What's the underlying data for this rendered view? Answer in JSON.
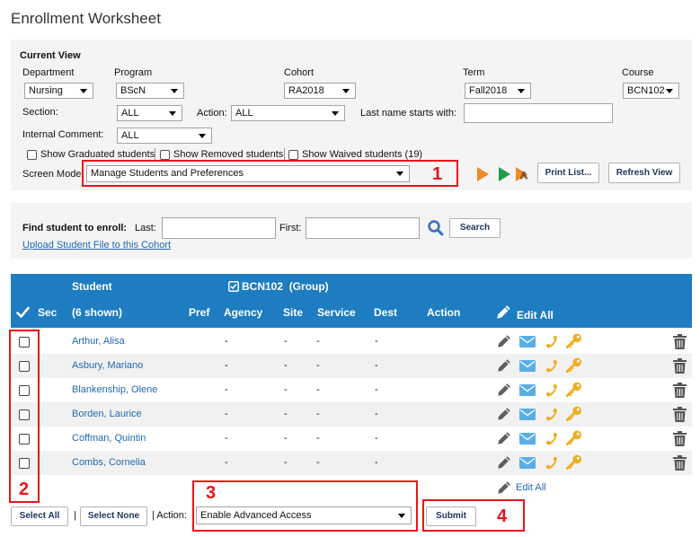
{
  "page": {
    "title": "Enrollment Worksheet"
  },
  "current_view": {
    "heading": "Current View",
    "department": {
      "label": "Department",
      "value": "Nursing"
    },
    "program": {
      "label": "Program",
      "value": "BScN"
    },
    "cohort": {
      "label": "Cohort",
      "value": "RA2018"
    },
    "term": {
      "label": "Term",
      "value": "Fall2018"
    },
    "course": {
      "label": "Course",
      "value": "BCN102"
    },
    "section": {
      "label": "Section:",
      "value": "ALL"
    },
    "action": {
      "label": "Action:",
      "value": "ALL"
    },
    "last_name": {
      "label": "Last name starts with:",
      "value": ""
    },
    "internal_comment": {
      "label": "Internal Comment:",
      "value": "ALL"
    },
    "show_options": [
      {
        "label": "Show Graduated students",
        "checked": false
      },
      {
        "label": "Show Removed students",
        "checked": false
      },
      {
        "label": "Show Waived students (19)",
        "checked": false
      }
    ],
    "screen_mode": {
      "label": "Screen Mode:",
      "value": "Manage Students and Preferences"
    },
    "mode_icons": [
      {
        "icon": "play-orange-icon",
        "color": "#f08a24"
      },
      {
        "icon": "play-green-icon",
        "color": "#1f9d4b"
      },
      {
        "icon": "advanced-play-icon",
        "color": "#f08a24",
        "letter": "A"
      }
    ],
    "print_button": "Print List...",
    "refresh_button": "Refresh View"
  },
  "find": {
    "label": "Find student to enroll:",
    "last_label": "Last:",
    "last_value": "",
    "first_label": "First:",
    "first_value": "",
    "search_icon": "search-icon",
    "search_button": "Search",
    "upload_link": "Upload Student File to this Cohort"
  },
  "table": {
    "header": {
      "student": "Student",
      "group": "BCN102  (Group)",
      "sec": "Sec",
      "shown": "(6 shown)",
      "pref": "Pref",
      "agency": "Agency",
      "site": "Site",
      "service": "Service",
      "dest": "Dest",
      "action": "Action",
      "edit_all": "Edit All"
    },
    "row_icons": [
      "pencil-icon",
      "envelope-icon",
      "phone-icon",
      "key-icon",
      "trash-icon"
    ],
    "rows": [
      {
        "name": "Arthur, Alisa",
        "agency": "-",
        "site": "-",
        "service": "-",
        "dest": "-"
      },
      {
        "name": "Asbury, Mariano",
        "agency": "-",
        "site": "-",
        "service": "-",
        "dest": "-"
      },
      {
        "name": "Blankenship, Olene",
        "agency": "-",
        "site": "-",
        "service": "-",
        "dest": "-"
      },
      {
        "name": "Borden, Laurice",
        "agency": "-",
        "site": "-",
        "service": "-",
        "dest": "-"
      },
      {
        "name": "Coffman, Quintin",
        "agency": "-",
        "site": "-",
        "service": "-",
        "dest": "-"
      },
      {
        "name": "Combs, Cornelia",
        "agency": "-",
        "site": "-",
        "service": "-",
        "dest": "-"
      }
    ],
    "footer_edit_all": "Edit All"
  },
  "bottom": {
    "select_all": "Select All",
    "separator": "|",
    "select_none": "Select None",
    "action_label": "| Action:",
    "action_value": "Enable Advanced Access",
    "submit": "Submit"
  },
  "annotations": {
    "one": "1",
    "two": "2",
    "three": "3",
    "four": "4"
  },
  "colors": {
    "header_blue": "#1e7cc1",
    "link_blue": "#2169b3",
    "annotation_red": "#e8141b",
    "panel_gray": "#f4f4f4",
    "icon_gold": "#f0ad1e",
    "envelope_blue": "#5aaee6"
  }
}
